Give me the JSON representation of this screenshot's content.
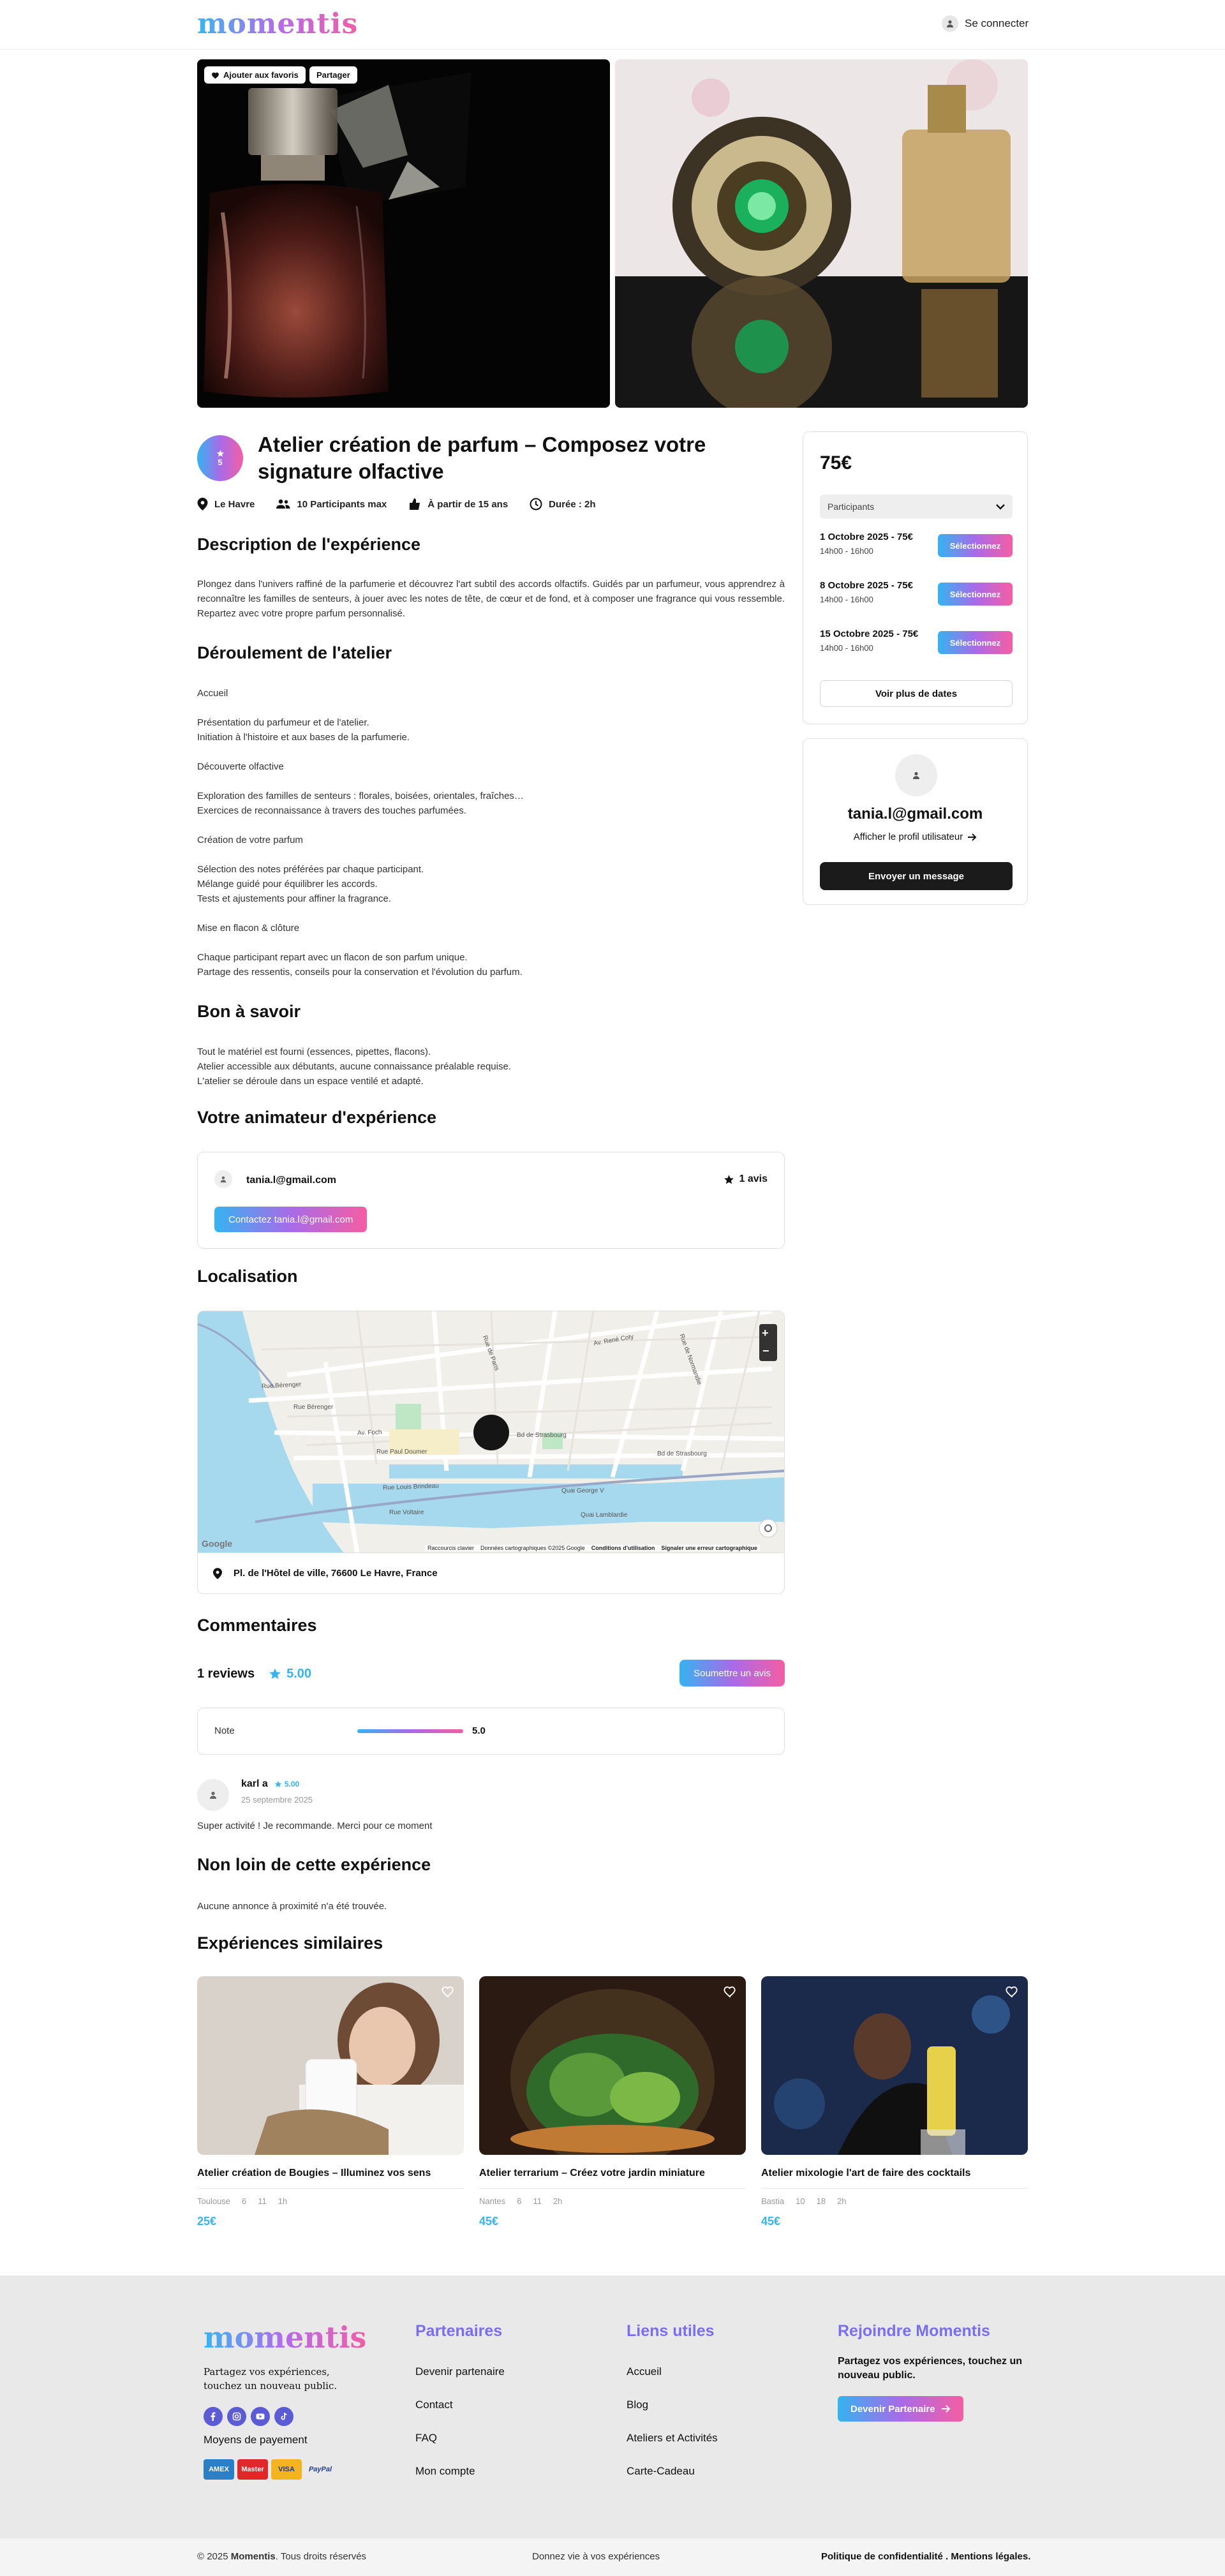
{
  "brand": {
    "name": "momentis"
  },
  "header": {
    "login_label": "Se connecter"
  },
  "gallery": {
    "favorite_label": "Ajouter aux favoris",
    "share_label": "Partager"
  },
  "experience": {
    "avatar_rating": "5",
    "title": "Atelier création de parfum – Composez votre signature olfactive",
    "meta": {
      "city": "Le Havre",
      "participants": "10 Participants max",
      "age": "À partir de 15 ans",
      "duration": "Durée : 2h"
    }
  },
  "description": {
    "heading": "Description de l'expérience",
    "text": "Plongez dans l'univers raffiné de la parfumerie et découvrez l'art subtil des accords olfactifs. Guidés par un parfumeur, vous apprendrez à reconnaître les familles de senteurs, à jouer avec les notes de tête, de cœur et de fond, et à composer une fragrance qui vous ressemble. Repartez avec votre propre parfum personnalisé."
  },
  "program": {
    "heading": "Déroulement de l'atelier",
    "lines": [
      "Accueil",
      "",
      "Présentation du parfumeur et de l'atelier.",
      "Initiation à l'histoire et aux bases de la parfumerie.",
      "",
      "Découverte olfactive",
      "",
      "Exploration des familles de senteurs : florales, boisées, orientales, fraîches…",
      "Exercices de reconnaissance à travers des touches parfumées.",
      "",
      "Création de votre parfum",
      "",
      "Sélection des notes préférées par chaque participant.",
      "Mélange guidé pour équilibrer les accords.",
      "Tests et ajustements pour affiner la fragrance.",
      "",
      "Mise en flacon & clôture",
      "",
      "Chaque participant repart avec un flacon de son parfum unique.",
      "Partage des ressentis, conseils pour la conservation et l'évolution du parfum."
    ]
  },
  "good_to_know": {
    "heading": "Bon à savoir",
    "lines": [
      "Tout le matériel est fourni (essences, pipettes, flacons).",
      "Atelier accessible aux débutants, aucune connaissance préalable requise.",
      "L'atelier se déroule dans un espace ventilé et adapté."
    ]
  },
  "animator": {
    "heading": "Votre animateur d'expérience",
    "email": "tania.l@gmail.com",
    "reviews": "1 avis",
    "contact_label": "Contactez tania.l@gmail.com"
  },
  "location": {
    "heading": "Localisation",
    "address": "Pl. de l'Hôtel de ville, 76600 Le Havre, France",
    "map": {
      "streets": [
        "Rue de Paris",
        "Bd de Strasbourg",
        "Quai George V",
        "Av. Foch",
        "Rue Bérenger",
        "Rue Louis Brindeau",
        "Rue Voltaire",
        "Quai Lamblardie",
        "Av. René Coty",
        "Rue de Normandie",
        "Rue Paul Doumer"
      ],
      "google": "Google",
      "attrib": [
        "Raccourcis clavier",
        "Données cartographiques ©2025 Google",
        "Conditions d'utilisation",
        "Signaler une erreur cartographique"
      ],
      "zoom_in": "+",
      "zoom_out": "−"
    }
  },
  "comments": {
    "heading": "Commentaires",
    "count_label": "1 reviews",
    "score": "5.00",
    "submit_label": "Soumettre un avis",
    "note_label": "Note",
    "note_value": "5.0",
    "note_fraction": 1.0,
    "review": {
      "author": "karl a",
      "rating": "5.00",
      "date": "25 septembre 2025",
      "text": "Super activité ! Je recommande. Merci pour ce moment"
    }
  },
  "nearby": {
    "heading": "Non loin de cette expérience",
    "empty_text": "Aucune annonce à proximité n'a été trouvée."
  },
  "booking": {
    "price": "75€",
    "participants_placeholder": "Participants",
    "slots": [
      {
        "date": "1 Octobre 2025 - 75€",
        "hours": "14h00 - 16h00",
        "button": "Sélectionnez"
      },
      {
        "date": "8 Octobre 2025 - 75€",
        "hours": "14h00 - 16h00",
        "button": "Sélectionnez"
      },
      {
        "date": "15 Octobre 2025 - 75€",
        "hours": "14h00 - 16h00",
        "button": "Sélectionnez"
      }
    ],
    "more_label": "Voir plus de dates"
  },
  "host": {
    "name": "tania.l@gmail.com",
    "profile_link": "Afficher le profil utilisateur",
    "message_label": "Envoyer un message"
  },
  "similar": {
    "heading": "Expériences similaires",
    "items": [
      {
        "title": "Atelier création de Bougies – Illuminez vos sens",
        "city": "Toulouse",
        "people": "6",
        "age": "11",
        "duration": "1h",
        "price": "25€"
      },
      {
        "title": "Atelier terrarium – Créez votre jardin miniature",
        "city": "Nantes",
        "people": "6",
        "age": "11",
        "duration": "2h",
        "price": "45€"
      },
      {
        "title": "Atelier mixologie l'art de faire des cocktails",
        "city": "Bastia",
        "people": "10",
        "age": "18",
        "duration": "2h",
        "price": "45€"
      }
    ]
  },
  "footer": {
    "tagline": "Partagez vos expériences, touchez un nouveau public.",
    "payment_title": "Moyens de payement",
    "payments": [
      "AMEX",
      "Master",
      "VISA",
      "PayPal"
    ],
    "partners": {
      "heading": "Partenaires",
      "links": [
        "Devenir partenaire",
        "Contact",
        "FAQ",
        "Mon compte"
      ]
    },
    "useful": {
      "heading": "Liens utiles",
      "links": [
        "Accueil",
        "Blog",
        "Ateliers et Activités",
        "Carte-Cadeau"
      ]
    },
    "join": {
      "heading": "Rejoindre Momentis",
      "text": "Partagez vos expériences, touchez un nouveau public.",
      "button": "Devenir Partenaire"
    },
    "copyright_pre": "© 2025 ",
    "copyright_brand": "Momentis",
    "copyright_post": ". Tous droits réservés",
    "center": "Donnez vie à vos expériences",
    "privacy": "Politique de confidentialité",
    "legal": "Mentions légales."
  },
  "colors": {
    "accent_blue": "#34b4f2",
    "accent_pink": "#f25ea6",
    "accent_purple": "#7b6df0",
    "dark": "#1b1b1b"
  }
}
